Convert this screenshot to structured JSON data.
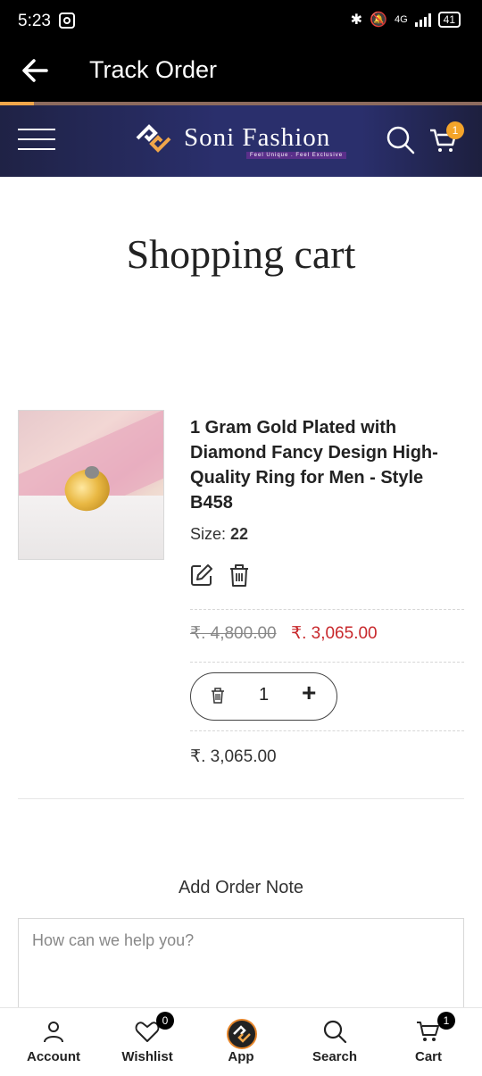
{
  "status_bar": {
    "time": "5:23",
    "network": "4G",
    "battery": "41"
  },
  "app_bar": {
    "title": "Track Order",
    "progress_fraction": 0.07
  },
  "site_header": {
    "logo_text": "Soni Fashion",
    "logo_tagline": "Feel Unique . Feel Exclusive",
    "cart_count": "1"
  },
  "page": {
    "title": "Shopping cart"
  },
  "cart_item": {
    "title": "1 Gram Gold Plated with Diamond Fancy Design High-Quality Ring for Men - Style B458",
    "size_label": "Size:",
    "size_value": "22",
    "price_original": "₹. 4,800.00",
    "price_sale": "₹. 3,065.00",
    "quantity": "1",
    "line_total": "₹. 3,065.00"
  },
  "order_note": {
    "label": "Add Order Note",
    "placeholder": "How can we help you?"
  },
  "bottom_nav": [
    {
      "label": "Account",
      "icon": "user-icon"
    },
    {
      "label": "Wishlist",
      "icon": "heart-icon",
      "badge": "0"
    },
    {
      "label": "App",
      "icon": "app-logo-icon"
    },
    {
      "label": "Search",
      "icon": "search-icon"
    },
    {
      "label": "Cart",
      "icon": "cart-icon",
      "badge": "1"
    }
  ],
  "colors": {
    "header_bg": "#2a2f6c",
    "accent": "#f4a42a",
    "sale_price": "#c8282c"
  }
}
